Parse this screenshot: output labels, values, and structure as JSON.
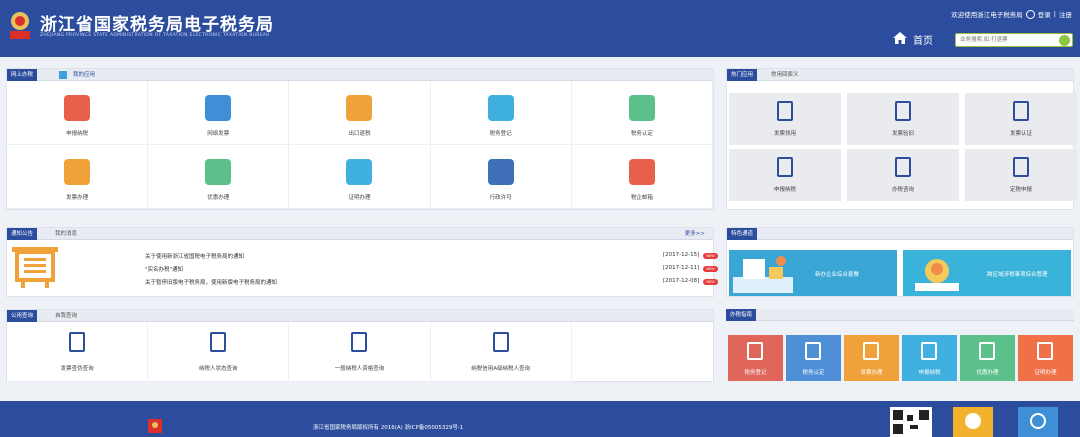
{
  "header": {
    "title": "浙江省国家税务局电子税务局",
    "subtitle": "ZHEJIANG PROVINCE STATE ADMINISTRATION OF TAXATION ELECTRONIC TAXATION BUREAU",
    "welcome": "欢迎使用浙江电子税务局",
    "login": "登录",
    "register": "注册",
    "separator": "|",
    "home": "首页",
    "search_placeholder": "业务搜索,如:打退票",
    "colors": {
      "bar": "#2c4d9e",
      "accent": "#8dc63f"
    }
  },
  "online": {
    "tabs": [
      "网上办税",
      "我的应用"
    ],
    "items": [
      {
        "label": "申报纳税",
        "icon": "tax-declare-icon",
        "color": "#e8604c"
      },
      {
        "label": "网络发票",
        "icon": "printer-icon",
        "color": "#3f8fd6"
      },
      {
        "label": "出口退税",
        "icon": "export-refund-icon",
        "color": "#f0a13a"
      },
      {
        "label": "税务登记",
        "icon": "tax-register-icon",
        "color": "#3fb0e0"
      },
      {
        "label": "税务认定",
        "icon": "tax-certify-icon",
        "color": "#5cc08a"
      },
      {
        "label": "发票办理",
        "icon": "invoice-certificate-icon",
        "color": "#f0a13a"
      },
      {
        "label": "优惠办理",
        "icon": "discount-icon",
        "color": "#5cc08a"
      },
      {
        "label": "证明办理",
        "icon": "certificate-icon",
        "color": "#3fb0e0"
      },
      {
        "label": "行政许可",
        "icon": "books-icon",
        "color": "#3f6fb6"
      },
      {
        "label": "税企邮箱",
        "icon": "mail-icon",
        "color": "#e8604c"
      }
    ]
  },
  "hot": {
    "tabs": [
      "热门应用",
      "常用回索义"
    ],
    "items": [
      {
        "label": "发票领用",
        "icon": "invoice-receive-icon"
      },
      {
        "label": "发票验旧",
        "icon": "invoice-check-icon"
      },
      {
        "label": "发票认证",
        "icon": "invoice-auth-icon"
      },
      {
        "label": "申报纳税",
        "icon": "declare-upload-icon"
      },
      {
        "label": "办税咨询",
        "icon": "consult-icon"
      },
      {
        "label": "定税申报",
        "icon": "clipboard-person-icon"
      }
    ]
  },
  "notice": {
    "tabs": [
      "通知公告",
      "我的消息"
    ],
    "more": "更多>>",
    "new_label": "NEW",
    "rows": [
      {
        "text": "关于使用新浙江省国税电子税务局的通知",
        "date": "[2017-12-15]"
      },
      {
        "text": "\"实名办税\"通知",
        "date": "[2017-12-11]"
      },
      {
        "text": "关于暂停旧版电子税务局，使用新版电子税务局的通知",
        "date": "[2017-12-08]"
      }
    ]
  },
  "features": {
    "tabs": [
      "特色通道"
    ],
    "cards": [
      {
        "label": "新办企业综合套餐",
        "color": "#3aa6d6"
      },
      {
        "label": "跨区域涉税事项综合管理",
        "color": "#39b3d9"
      }
    ]
  },
  "query": {
    "tabs": [
      "公用查询",
      "自我查询"
    ],
    "items": [
      {
        "label": "发票查伪查询",
        "icon": "invoice-search-icon"
      },
      {
        "label": "纳税人状态查询",
        "icon": "taxpayer-status-icon"
      },
      {
        "label": "一般纳税人资格查询",
        "icon": "taxpayer-qualify-icon"
      },
      {
        "label": "纳税信用A级纳税人查询",
        "icon": "credit-search-icon"
      }
    ]
  },
  "guide": {
    "tabs": [
      "办税指南"
    ],
    "items": [
      {
        "label": "税务登记",
        "color": "#e0655a"
      },
      {
        "label": "税务认定",
        "color": "#4f8fd8"
      },
      {
        "label": "发票办理",
        "color": "#f0a13a"
      },
      {
        "label": "申报纳税",
        "color": "#3fb0e0"
      },
      {
        "label": "优惠办理",
        "color": "#5cc08a"
      },
      {
        "label": "证明办理",
        "color": "#f07048"
      }
    ]
  },
  "footer": {
    "copyright": "浙江省国家税务局版权所有 2016(A) 浙ICP备05005329号-1"
  }
}
